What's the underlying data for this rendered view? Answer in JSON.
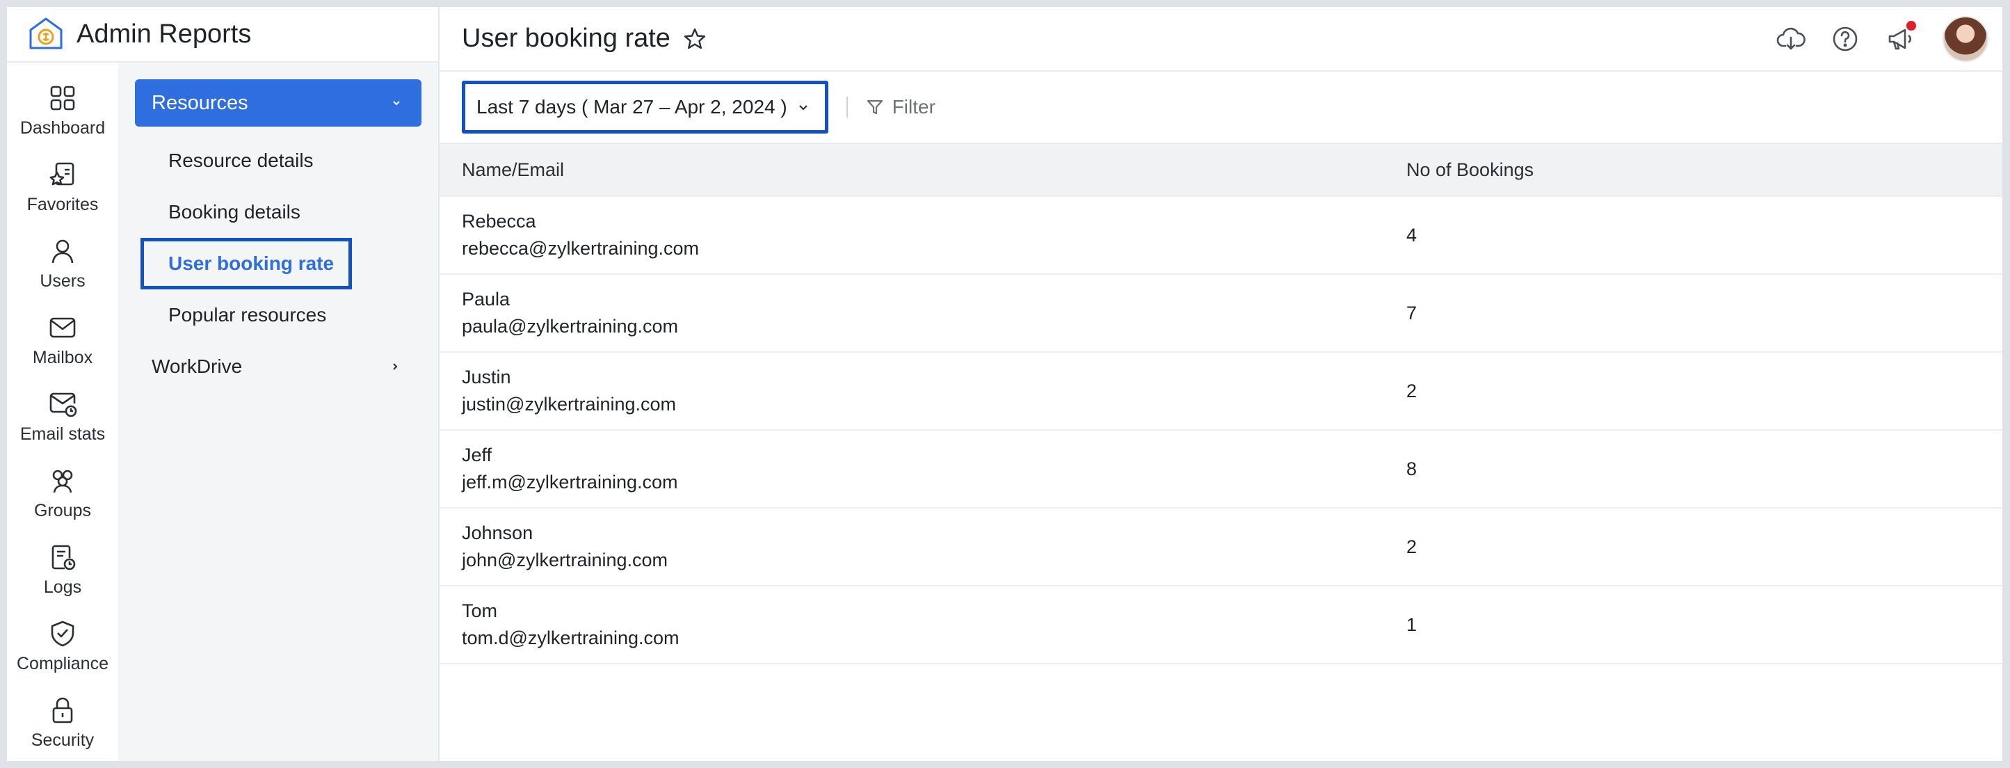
{
  "app": {
    "title": "Admin Reports"
  },
  "rail": [
    {
      "id": "dashboard",
      "label": "Dashboard",
      "icon": "dashboard-icon"
    },
    {
      "id": "favorites",
      "label": "Favorites",
      "icon": "favorites-icon"
    },
    {
      "id": "users",
      "label": "Users",
      "icon": "user-icon"
    },
    {
      "id": "mailbox",
      "label": "Mailbox",
      "icon": "mailbox-icon"
    },
    {
      "id": "email-stats",
      "label": "Email stats",
      "icon": "email-stats-icon"
    },
    {
      "id": "groups",
      "label": "Groups",
      "icon": "groups-icon"
    },
    {
      "id": "logs",
      "label": "Logs",
      "icon": "logs-icon"
    },
    {
      "id": "compliance",
      "label": "Compliance",
      "icon": "shield-check-icon"
    },
    {
      "id": "security",
      "label": "Security",
      "icon": "lock-icon"
    }
  ],
  "submenu": {
    "section": "Resources",
    "items": [
      {
        "label": "Resource details",
        "active": false
      },
      {
        "label": "Booking details",
        "active": false
      },
      {
        "label": "User booking rate",
        "active": true
      },
      {
        "label": "Popular resources",
        "active": false
      }
    ],
    "workdrive": "WorkDrive"
  },
  "page": {
    "title": "User booking rate"
  },
  "toolbar": {
    "date_range": "Last 7 days ( Mar 27 – Apr 2, 2024 )",
    "filter_label": "Filter"
  },
  "table": {
    "headers": {
      "name": "Name/Email",
      "count": "No of Bookings"
    },
    "rows": [
      {
        "name": "Rebecca",
        "email": "rebecca@zylkertraining.com",
        "count": "4"
      },
      {
        "name": "Paula",
        "email": "paula@zylkertraining.com",
        "count": "7"
      },
      {
        "name": "Justin",
        "email": "justin@zylkertraining.com",
        "count": "2"
      },
      {
        "name": "Jeff",
        "email": "jeff.m@zylkertraining.com",
        "count": "8"
      },
      {
        "name": "Johnson",
        "email": "john@zylkertraining.com",
        "count": "2"
      },
      {
        "name": "Tom",
        "email": "tom.d@zylkertraining.com",
        "count": "1"
      }
    ]
  },
  "colors": {
    "accent": "#2f6ede",
    "highlight_border": "#1251c4",
    "notification": "#e01e2b"
  }
}
